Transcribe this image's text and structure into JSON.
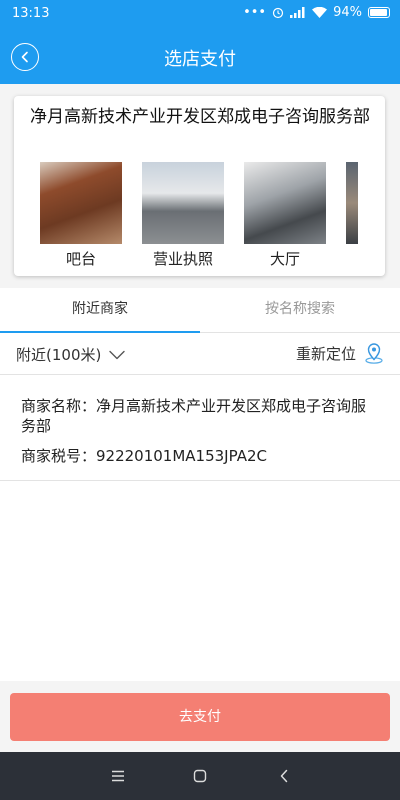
{
  "status_bar": {
    "time": "13:13",
    "battery": "94%",
    "icons": [
      "dots-icon",
      "alarm-icon",
      "signal-icon",
      "wifi-icon",
      "battery-icon"
    ]
  },
  "header": {
    "title": "选店支付",
    "back_icon": "back-arrow-icon",
    "bg_color": "#1e9cf0"
  },
  "merchant_card": {
    "name": "净月高新技术产业开发区郑成电子咨询服务部",
    "photos": [
      {
        "caption": "吧台"
      },
      {
        "caption": "营业执照"
      },
      {
        "caption": "大厅"
      },
      {
        "caption": ""
      }
    ]
  },
  "tabs": [
    {
      "label": "附近商家",
      "active": true
    },
    {
      "label": "按名称搜索",
      "active": false
    }
  ],
  "filter": {
    "range_label": "附近(100米)",
    "range_icon": "chevron-down-icon",
    "relocate_label": "重新定位",
    "relocate_icon": "location-pin-icon"
  },
  "results": [
    {
      "name_line": "商家名称：净月高新技术产业开发区郑成电子咨询服务部",
      "tax_line": "商家税号：92220101MA153JPA2C"
    }
  ],
  "pay_button": {
    "label": "去支付",
    "color": "#f47f73"
  },
  "nav_bar": {
    "icons": [
      "menu-icon",
      "home-icon",
      "back-icon"
    ]
  }
}
